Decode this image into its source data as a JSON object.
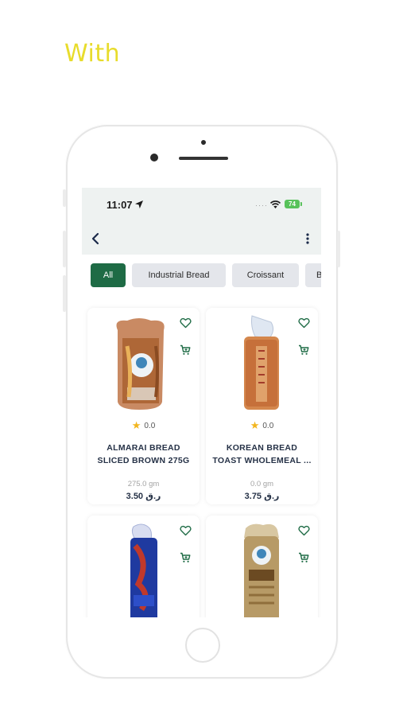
{
  "promo": {
    "text": "With"
  },
  "status_bar": {
    "time": "11:07",
    "battery": "74",
    "signal_dots": "····"
  },
  "categories": [
    {
      "label": "All",
      "active": true
    },
    {
      "label": "Industrial Bread",
      "active": false
    },
    {
      "label": "Croissant",
      "active": false
    },
    {
      "label": "B",
      "active": false
    }
  ],
  "products": [
    {
      "name": "ALMARAI BREAD SLICED BROWN 275G",
      "rating": "0.0",
      "weight": "275.0 gm",
      "price": "3.50 ر.ق"
    },
    {
      "name": "KOREAN BREAD TOAST WHOLEMEAL ...",
      "rating": "0.0",
      "weight": "0.0 gm",
      "price": "3.75 ر.ق"
    },
    {
      "name": "",
      "rating": "",
      "weight": "",
      "price": ""
    },
    {
      "name": "",
      "rating": "",
      "weight": "",
      "price": ""
    }
  ],
  "colors": {
    "accent": "#1e6b45",
    "promo": "#e8dc2c",
    "rating_star": "#f2b51d",
    "appbar": "#eef2f1"
  },
  "icons": {
    "back": "chevron-left-icon",
    "more": "more-vertical-icon",
    "favorite": "heart-outline-icon",
    "cart": "cart-icon",
    "star": "star-icon"
  }
}
